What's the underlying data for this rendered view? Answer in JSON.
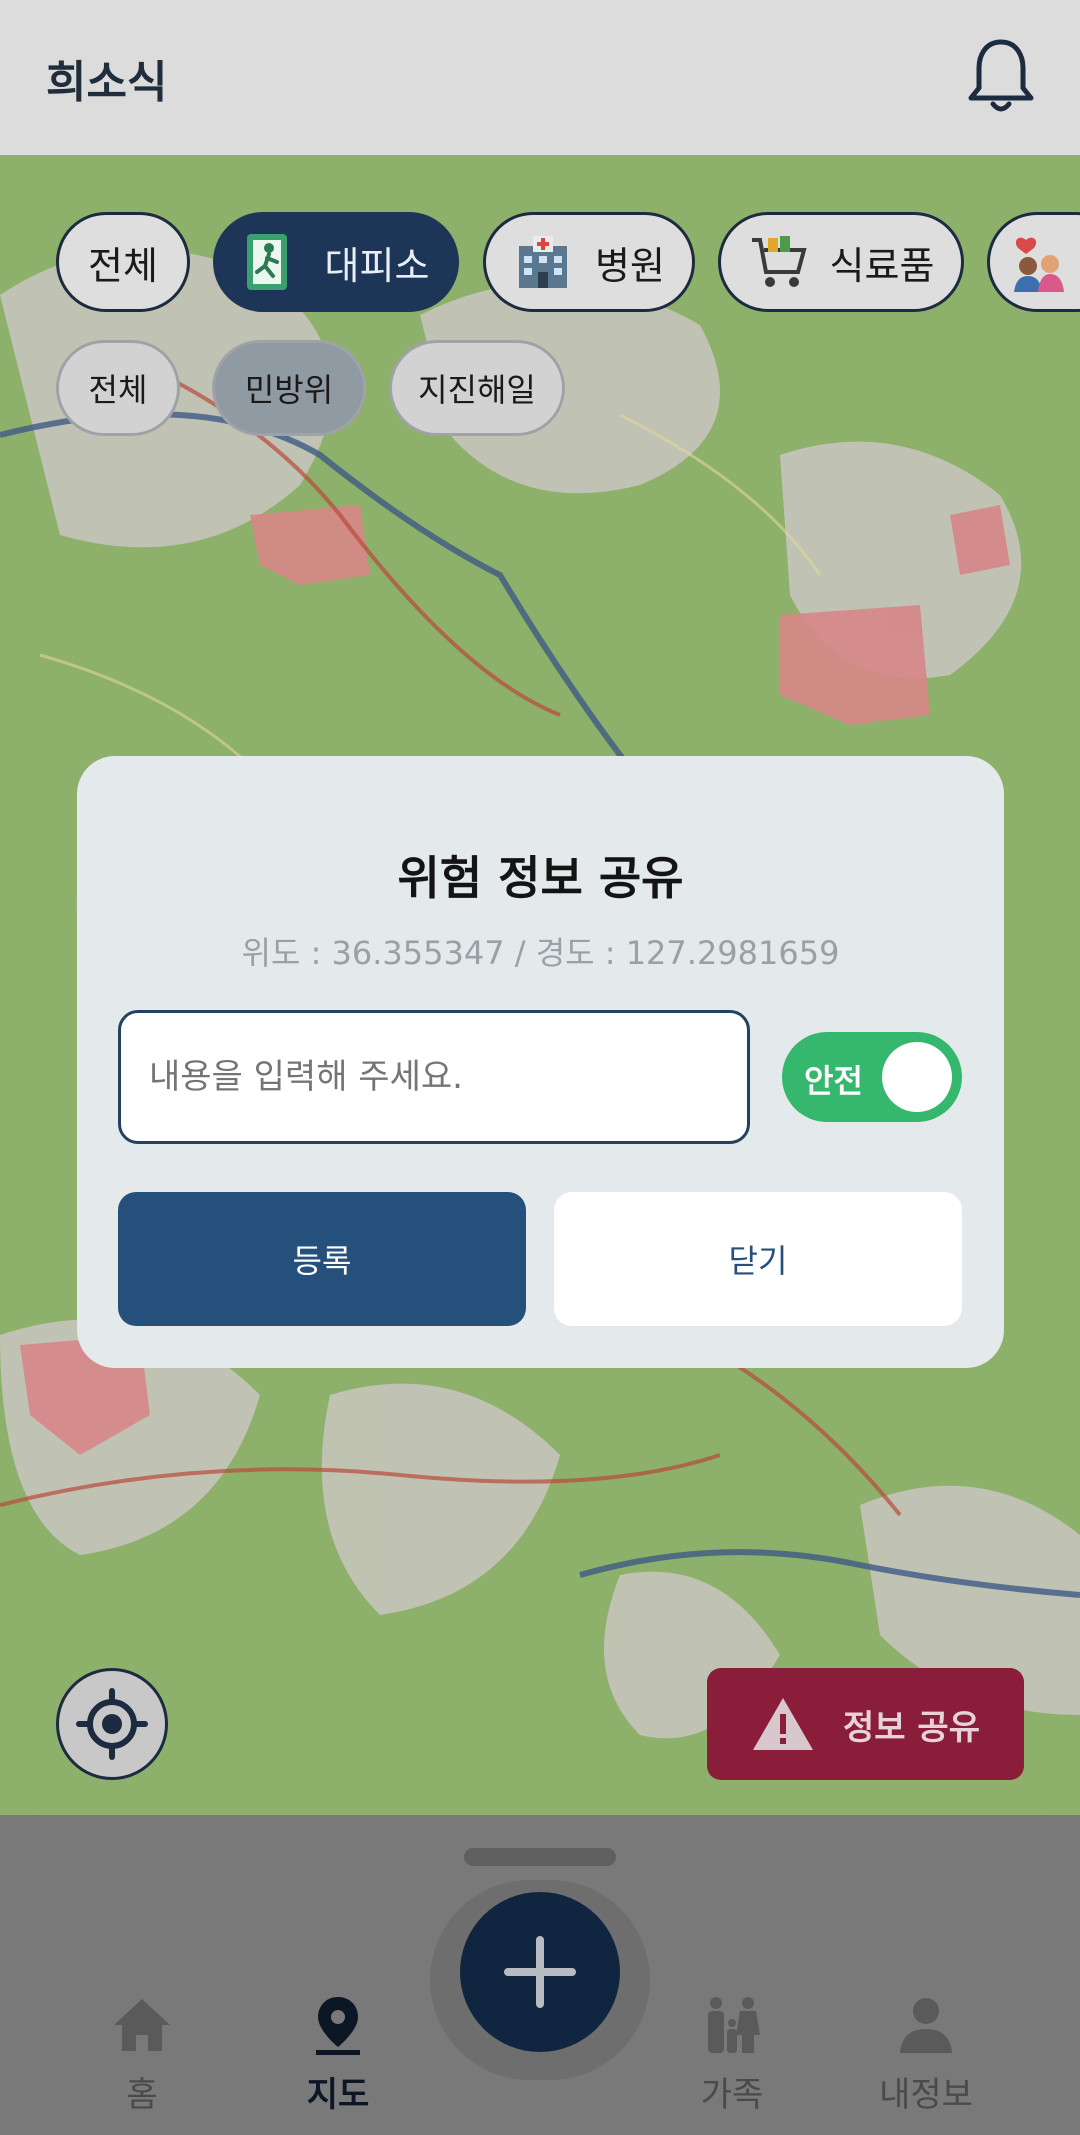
{
  "app": {
    "title": "희소식"
  },
  "header": {
    "bell_icon": "bell-icon"
  },
  "category_chips": [
    {
      "label": "전체",
      "active": false,
      "icon": ""
    },
    {
      "label": "대피소",
      "active": true,
      "icon": "emergency-exit-icon"
    },
    {
      "label": "병원",
      "active": false,
      "icon": "hospital-icon"
    },
    {
      "label": "식료품",
      "active": false,
      "icon": "grocery-cart-icon"
    }
  ],
  "sub_chips": [
    {
      "label": "전체",
      "active": false
    },
    {
      "label": "민방위",
      "active": true
    },
    {
      "label": "지진해일",
      "active": false
    }
  ],
  "share_button": {
    "label": "정보 공유",
    "color": "#b8204a"
  },
  "modal": {
    "title": "위험 정보 공유",
    "coords": "위도 : 36.355347 / 경도 : 127.2981659",
    "input_placeholder": "내용을 입력해 주세요.",
    "toggle_label": "안전",
    "toggle_on": true,
    "submit_label": "등록",
    "close_label": "닫기"
  },
  "nav": {
    "items": [
      {
        "label": "홈",
        "icon": "home-icon",
        "active": false
      },
      {
        "label": "지도",
        "active": true,
        "icon": "map-pin-icon"
      },
      {
        "label": "가족",
        "icon": "family-icon",
        "active": false
      },
      {
        "label": "내정보",
        "icon": "user-icon",
        "active": false
      }
    ],
    "fab_icon": "plus-icon"
  },
  "colors": {
    "primary": "#26507c",
    "accent_green": "#35b86e",
    "dark_navy": "#1d3657"
  }
}
